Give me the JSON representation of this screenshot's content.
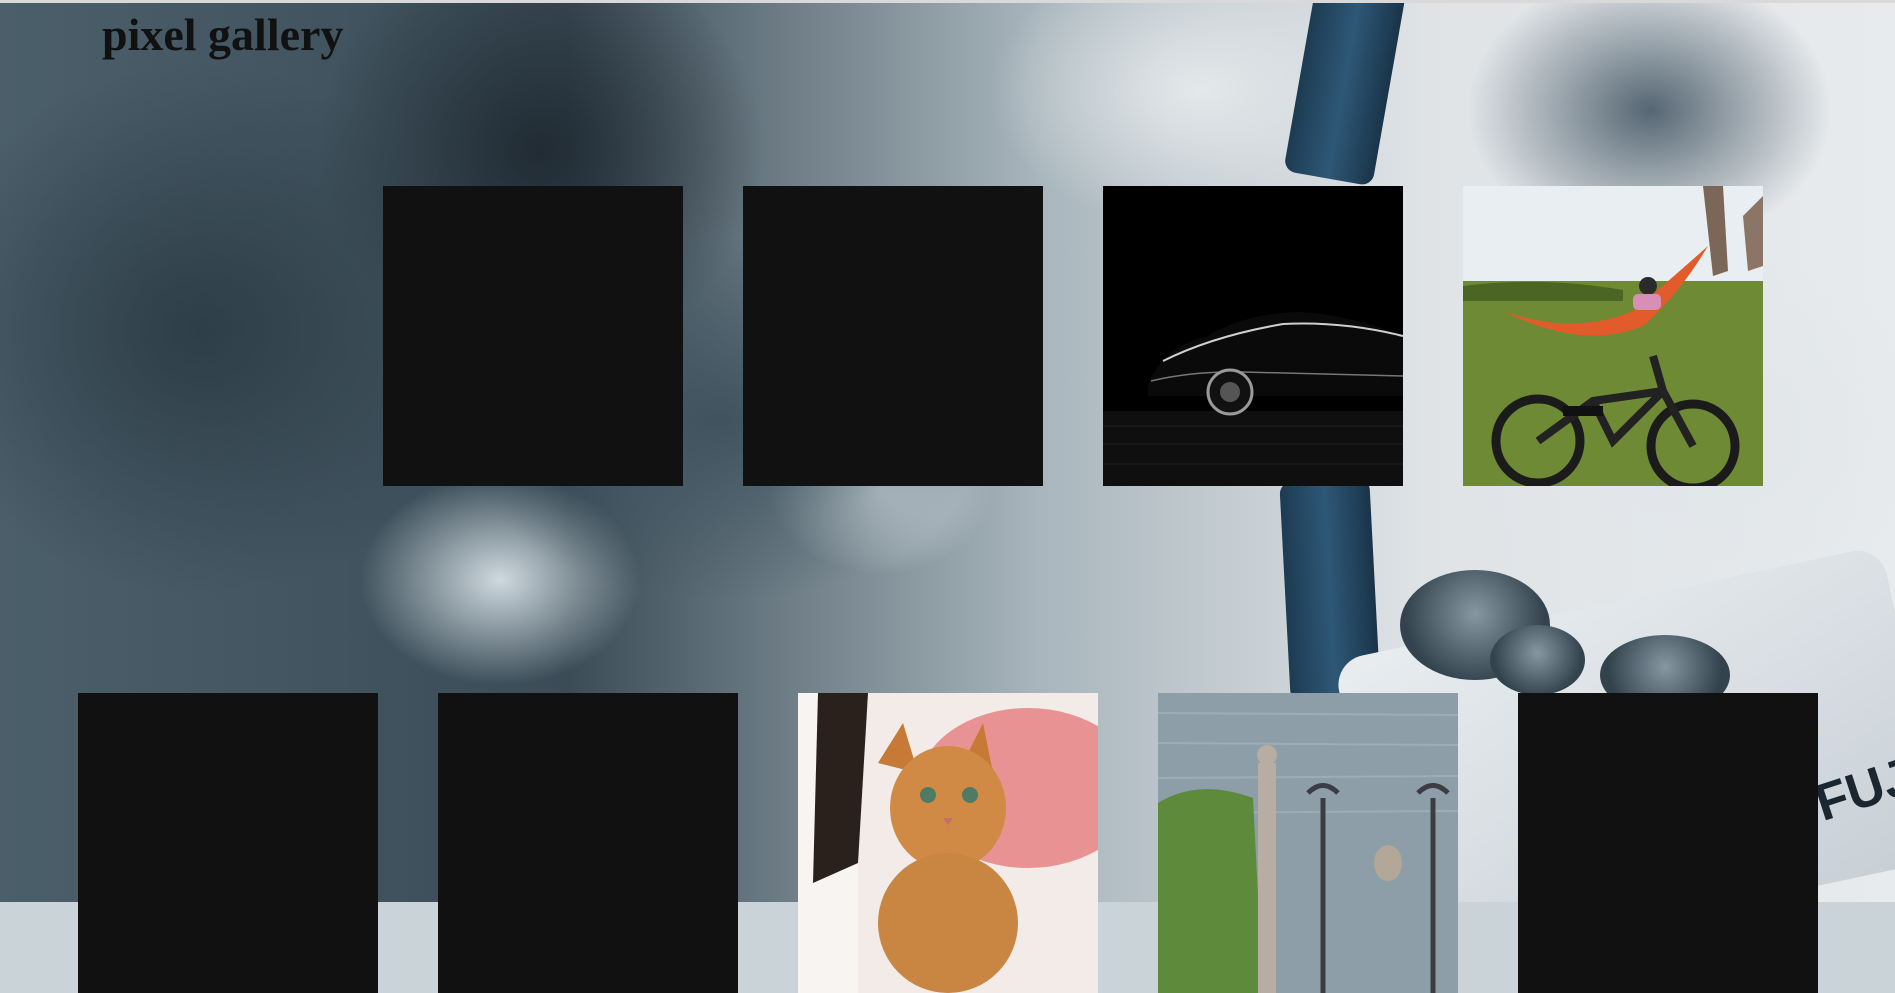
{
  "header": {
    "title": "pixel gallery"
  },
  "gallery": {
    "tiles": [
      {
        "state": "loading"
      },
      {
        "state": "loading"
      },
      {
        "state": "loaded",
        "subject": "car-photo"
      },
      {
        "state": "loaded",
        "subject": "hammock-bike-photo"
      },
      {
        "state": "loading"
      },
      {
        "state": "loading"
      },
      {
        "state": "loaded",
        "subject": "cat-photo"
      },
      {
        "state": "loaded",
        "subject": "lake-statue-photo"
      },
      {
        "state": "loading"
      }
    ]
  },
  "colors": {
    "placeholder": "#111111",
    "title": "#111111"
  }
}
